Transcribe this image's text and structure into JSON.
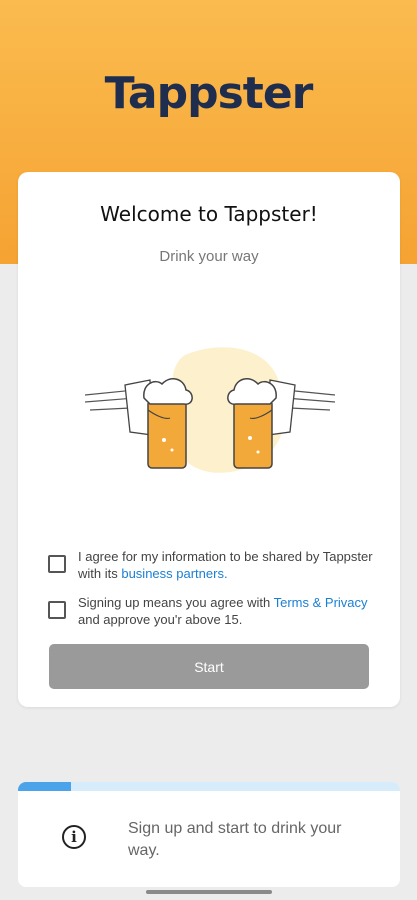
{
  "brand": {
    "logo_text": "Tappster",
    "accent": "#f5a332",
    "text_color": "#1f2d4f"
  },
  "welcome": {
    "title": "Welcome to Tappster!",
    "subtitle": "Drink your way"
  },
  "consents": [
    {
      "text": "I agree for my information to be shared by Tappster with its ",
      "link": "business partners",
      "suffix": ".",
      "checked": false
    },
    {
      "text": "Signing up means you agree with ",
      "link": "Terms & Privacy",
      "suffix": " and approve you'r above 15.",
      "checked": false
    }
  ],
  "start_button": {
    "label": "Start",
    "enabled": false
  },
  "info": {
    "icon": "info-icon",
    "text": "Sign up and start to drink your way.",
    "progress": 0.14
  },
  "colors": {
    "link": "#1a7fd4",
    "button_disabled": "#9a9a9a",
    "progress": "#4ba3ea"
  }
}
